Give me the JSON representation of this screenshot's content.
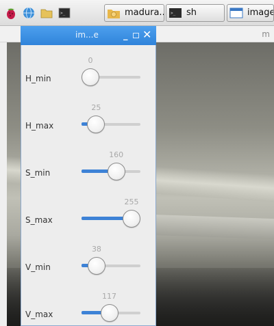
{
  "taskbar": {
    "icons": [
      {
        "name": "raspberry-menu-icon",
        "color": "#c51a4a"
      },
      {
        "name": "web-browser-icon",
        "color": "#3b8fd9"
      },
      {
        "name": "file-manager-icon",
        "color": "#e6c25a"
      },
      {
        "name": "terminal-icon",
        "color": "#2b2b2b"
      }
    ],
    "buttons": [
      {
        "label": "madura...",
        "icon": "user-home-folder-icon"
      },
      {
        "label": "sh",
        "icon": "terminal-icon"
      },
      {
        "label": "image",
        "icon": "window-icon"
      }
    ]
  },
  "background_window": {
    "title": "m"
  },
  "trackbar_window": {
    "title": "im...e",
    "controls": {
      "minimize": "_",
      "close": "✕"
    },
    "sliders": [
      {
        "label": "H_min",
        "value": 0,
        "max": 180
      },
      {
        "label": "H_max",
        "value": 25,
        "max": 180
      },
      {
        "label": "S_min",
        "value": 160,
        "max": 255
      },
      {
        "label": "S_max",
        "value": 255,
        "max": 255
      },
      {
        "label": "V_min",
        "value": 38,
        "max": 255
      },
      {
        "label": "V_max",
        "value": 117,
        "max": 255
      }
    ]
  },
  "colors": {
    "titlebar_blue": "#2f83da",
    "slider_fill": "#3d82d6"
  }
}
